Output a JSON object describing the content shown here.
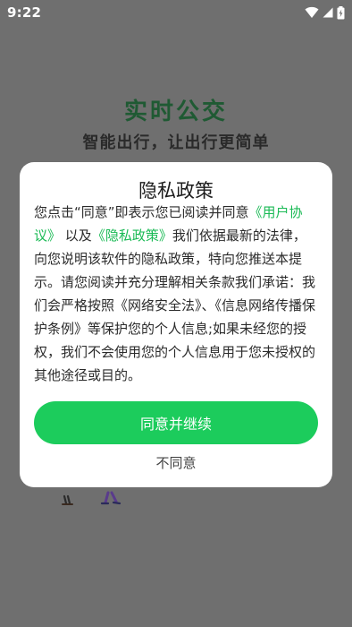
{
  "status_bar": {
    "time": "9:22",
    "icons": [
      "wifi-icon",
      "cellular-signal-icon",
      "battery-icon"
    ]
  },
  "splash": {
    "app_title": "实时公交",
    "slogan": "智能出行，让出行更简单"
  },
  "dialog": {
    "title": "隐私政策",
    "body": {
      "part1": "您点击“同意”即表示您已阅读并同意",
      "link_user_agreement": "《用户协议》",
      "part2": "以及",
      "link_privacy_policy": "《隐私政策》",
      "part3": "我们依据最新的法律，向您说明该软件的隐私政策，特向您推送本提示。请您阅读并充分理解相关条款我们承诺：我们会严格按照《网络安全法》、《信息网络传播保护条例》等保护您的个人信息;如果未经您的授权，我们不会使用您的个人信息用于您未授权的其他途径或目的。"
    },
    "agree_label": "同意并继续",
    "disagree_label": "不同意"
  },
  "colors": {
    "accent_green": "#1ccc5c",
    "link_green": "#1aba55",
    "overlay_gray": "#6f6f6f"
  }
}
